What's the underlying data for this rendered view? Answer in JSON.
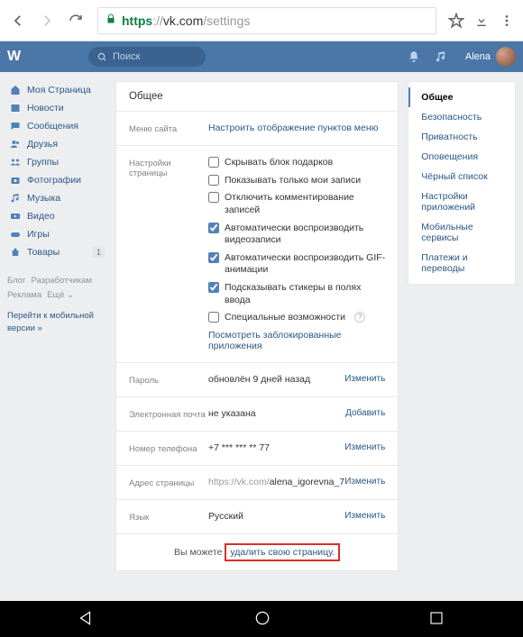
{
  "browser": {
    "protocol": "https",
    "sep": "://",
    "domain": "vk.com",
    "path": "/settings"
  },
  "header": {
    "search_placeholder": "Поиск",
    "username": "Alena"
  },
  "sidebar": {
    "items": [
      {
        "icon": "home",
        "label": "Моя Страница"
      },
      {
        "icon": "news",
        "label": "Новости"
      },
      {
        "icon": "msg",
        "label": "Сообщения"
      },
      {
        "icon": "friends",
        "label": "Друзья"
      },
      {
        "icon": "groups",
        "label": "Группы"
      },
      {
        "icon": "photos",
        "label": "Фотографии"
      },
      {
        "icon": "music",
        "label": "Музыка"
      },
      {
        "icon": "video",
        "label": "Видео"
      },
      {
        "icon": "games",
        "label": "Игры"
      },
      {
        "icon": "market",
        "label": "Товары",
        "badge": "1"
      }
    ],
    "footer": {
      "l1a": "Блог",
      "l1b": "Разработчикам",
      "l2a": "Реклама",
      "l2b": "Ещё ⌄"
    },
    "mobile": "Перейти к мобильной версии »"
  },
  "settings": {
    "title": "Общее",
    "menu": {
      "label": "Меню сайта",
      "link": "Настроить отображение пунктов меню"
    },
    "page": {
      "label": "Настройки страницы",
      "c1": "Скрывать блок подарков",
      "c2": "Показывать только мои записи",
      "c3": "Отключить комментирование записей",
      "c4": "Автоматически воспроизводить видеозаписи",
      "c5": "Автоматически воспроизводить GIF-анимации",
      "c6": "Подсказывать стикеры в полях ввода",
      "c7": "Специальные возможности",
      "blocked": "Посмотреть заблокированные приложения"
    },
    "password": {
      "label": "Пароль",
      "value": "обновлён 9 дней назад",
      "action": "Изменить"
    },
    "email": {
      "label": "Электронная почта",
      "value": "не указана",
      "action": "Добавить"
    },
    "phone": {
      "label": "Номер телефона",
      "value": "+7 *** *** ** 77",
      "action": "Изменить"
    },
    "address": {
      "label": "Адрес страницы",
      "prefix": "https://vk.com/",
      "user": "alena_igorevna_7",
      "action": "Изменить"
    },
    "lang": {
      "label": "Язык",
      "value": "Русский",
      "action": "Изменить"
    },
    "delete": {
      "pre": "Вы можете ",
      "link": "удалить свою страницу."
    }
  },
  "tabs": [
    "Общее",
    "Безопасность",
    "Приватность",
    "Оповещения",
    "Чёрный список",
    "Настройки приложений",
    "Мобильные сервисы",
    "Платежи и переводы"
  ]
}
